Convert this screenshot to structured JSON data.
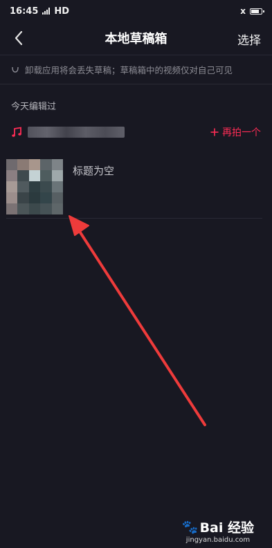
{
  "status_bar": {
    "time": "16:45",
    "network": "HD"
  },
  "header": {
    "title": "本地草稿箱",
    "select_label": "选择"
  },
  "notice": {
    "text": "卸载应用将会丢失草稿；草稿箱中的视频仅对自己可见"
  },
  "section": {
    "label": "今天编辑过"
  },
  "music": {
    "reshoot_label": "再拍一个"
  },
  "drafts": [
    {
      "title": "标题为空"
    }
  ],
  "watermark": {
    "logo": "Bai 经验",
    "url": "jingyan.baidu.com"
  },
  "colors": {
    "background": "#181822",
    "accent": "#fe2c55",
    "arrow": "#ee3b3b"
  },
  "icons": [
    "back-chevron-icon",
    "smile-icon",
    "music-note-icon",
    "plus-icon",
    "signal-icon",
    "battery-icon",
    "paw-icon"
  ]
}
